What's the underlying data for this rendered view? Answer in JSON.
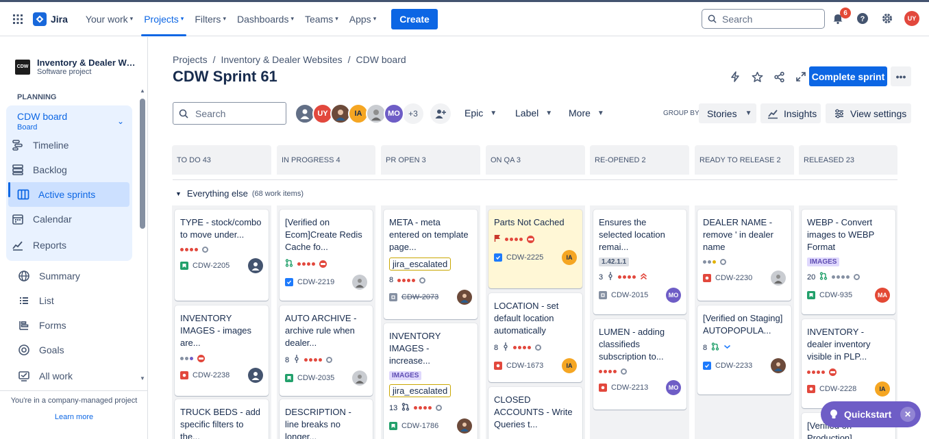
{
  "topnav": {
    "product": "Jira",
    "items": [
      "Your work",
      "Projects",
      "Filters",
      "Dashboards",
      "Teams",
      "Apps"
    ],
    "create": "Create",
    "search_placeholder": "Search",
    "notif_count": "6",
    "user_initials": "UY"
  },
  "sidebar": {
    "project_logo": "CDW",
    "project_name": "Inventory & Dealer Websites",
    "project_type": "Software project",
    "planning": "PLANNING",
    "board": "CDW board",
    "board_sub": "Board",
    "planning_items": [
      "Timeline",
      "Backlog",
      "Active sprints",
      "Calendar",
      "Reports"
    ],
    "other_items": [
      "Summary",
      "List",
      "Forms",
      "Goals",
      "All work"
    ],
    "footer": "You're in a company-managed project",
    "learn_more": "Learn more"
  },
  "header": {
    "breadcrumbs": [
      "Projects",
      "/",
      "Inventory & Dealer Websites",
      "/",
      "CDW board"
    ],
    "title": "CDW Sprint 61",
    "complete": "Complete sprint",
    "more": "•••"
  },
  "toolbar": {
    "search_placeholder": "Search",
    "avatars": [
      {
        "initials": "",
        "color": "#626F86"
      },
      {
        "initials": "UY",
        "color": "#E2483D"
      },
      {
        "initials": "",
        "color": "#6C4A3A"
      },
      {
        "initials": "IA",
        "color": "#F5A623"
      },
      {
        "initials": "",
        "color": "#C9CCD1"
      },
      {
        "initials": "MO",
        "color": "#6E5DC6"
      }
    ],
    "more_count": "+3",
    "filters": [
      "Epic",
      "Label",
      "More"
    ],
    "group_by": "GROUP BY",
    "stories": "Stories",
    "insights": "Insights",
    "view_settings": "View settings"
  },
  "columns": [
    "TO DO 43",
    "IN PROGRESS 4",
    "PR OPEN 3",
    "ON QA 3",
    "RE-OPENED 2",
    "READY TO RELEASE 2",
    "RELEASED 23"
  ],
  "swimlane": {
    "name": "Everything else",
    "count": "(68 work items)"
  },
  "cards": {
    "c0a": {
      "title": "TYPE - stock/combo to move under...",
      "key": "CDW-2205"
    },
    "c0b": {
      "title": "INVENTORY IMAGES - images are...",
      "key": "CDW-2238"
    },
    "c0c": {
      "title": "TRUCK BEDS - add specific filters to the..."
    },
    "c1a": {
      "title": "[Verified on Ecom]Create Redis Cache fo...",
      "key": "CDW-2219"
    },
    "c1b": {
      "title": "AUTO ARCHIVE - archive rule when dealer...",
      "key": "CDW-2035",
      "num": "8"
    },
    "c1c": {
      "title": "DESCRIPTION - line breaks no longer..."
    },
    "c2a": {
      "title": "META - meta entered on template page...",
      "tag": "jira_escalated",
      "num": "8",
      "key": "CDW-2073"
    },
    "c2b": {
      "title": "INVENTORY IMAGES - increase...",
      "label": "IMAGES",
      "tag": "jira_escalated",
      "num": "13",
      "key": "CDW-1786"
    },
    "c3a": {
      "title": "Parts Not Cached",
      "key": "CDW-2225",
      "av": "IA"
    },
    "c3b": {
      "title": "LOCATION - set default location automatically",
      "num": "8",
      "key": "CDW-1673",
      "av": "IA"
    },
    "c3c": {
      "title": "CLOSED ACCOUNTS - Write Queries t..."
    },
    "c4a": {
      "title": "Ensures the selected location remai...",
      "label": "1.42.1.1",
      "num": "3",
      "key": "CDW-2015",
      "av": "MO"
    },
    "c4b": {
      "title": "LUMEN - adding classifieds subscription to...",
      "key": "CDW-2213",
      "av": "MO"
    },
    "c5a": {
      "title": "DEALER NAME - remove ' in dealer name",
      "key": "CDW-2230"
    },
    "c5b": {
      "title": "[Verified on Staging] AUTOPOPULA...",
      "num": "8",
      "key": "CDW-2233"
    },
    "c6a": {
      "title": "WEBP - Convert images to WEBP Format",
      "label": "IMAGES",
      "num": "20",
      "key": "CDW-935",
      "av": "MA"
    },
    "c6b": {
      "title": "INVENTORY - dealer inventory visible in PLP...",
      "key": "CDW-2228",
      "av": "IA"
    },
    "c6c": {
      "title": "[Verified on Production]"
    }
  },
  "quickstart": {
    "label": "Quickstart",
    "close": "✕"
  }
}
